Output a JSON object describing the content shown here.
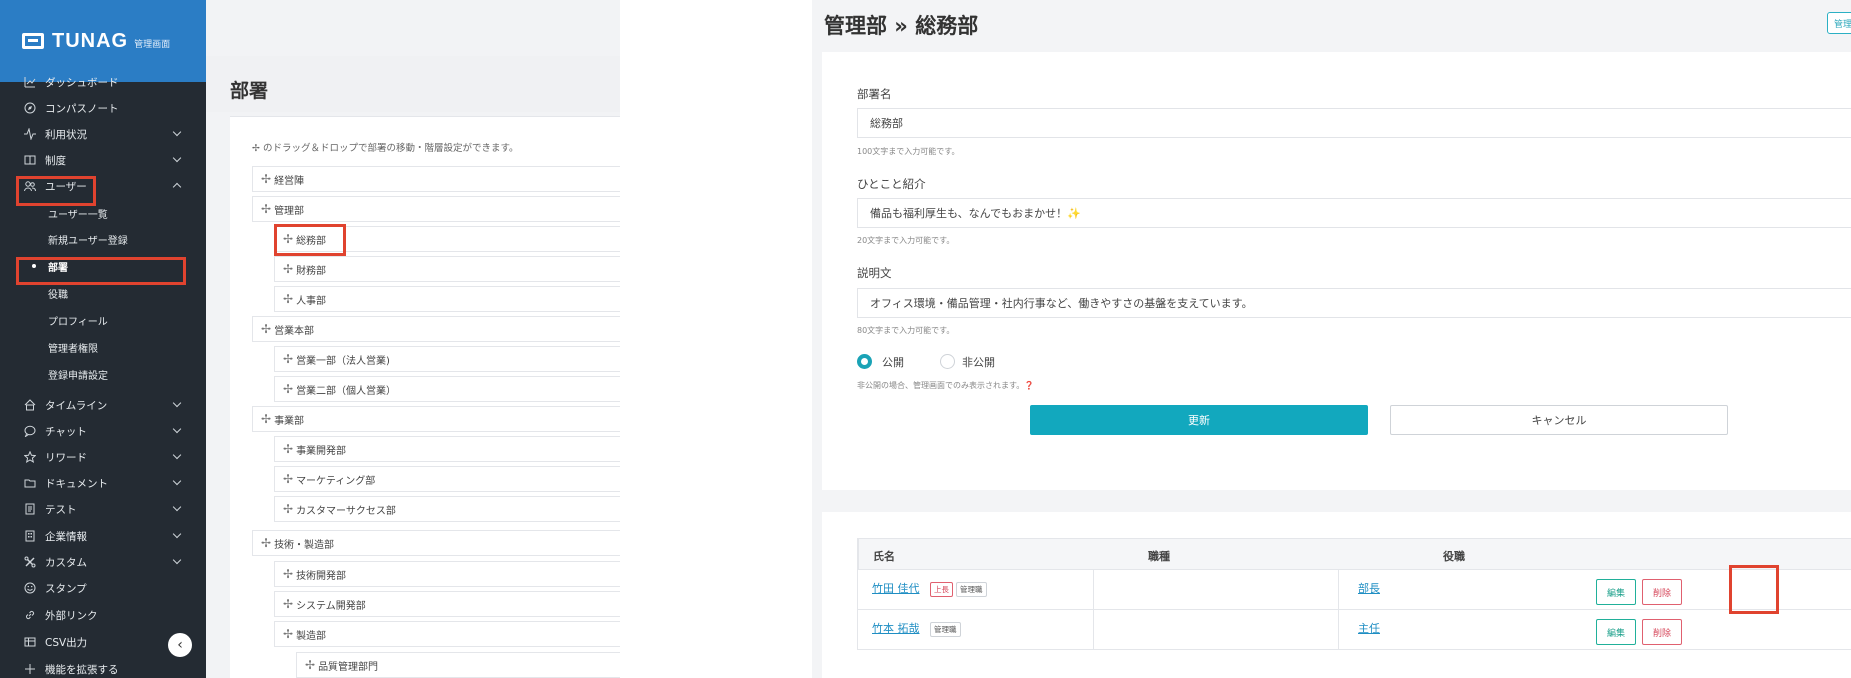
{
  "left": {
    "brand": {
      "name": "TUNAG",
      "sub": "管理画面"
    },
    "nav": [
      {
        "label": "ダッシュボード",
        "icon": "chart-line-icon",
        "chevron": false
      },
      {
        "label": "コンパスノート",
        "icon": "compass-icon",
        "chevron": false
      },
      {
        "label": "利用状況",
        "icon": "activity-icon",
        "chevron": "down"
      },
      {
        "label": "制度",
        "icon": "book-icon",
        "chevron": "down"
      },
      {
        "label": "ユーザー",
        "icon": "users-icon",
        "chevron": "up"
      }
    ],
    "user_sub": [
      {
        "label": "ユーザー一覧"
      },
      {
        "label": "新規ユーザー登録"
      },
      {
        "label": "部署",
        "active": true
      },
      {
        "label": "役職"
      },
      {
        "label": "プロフィール"
      },
      {
        "label": "管理者権限"
      },
      {
        "label": "登録申請設定"
      }
    ],
    "nav2": [
      {
        "label": "タイムライン",
        "icon": "home-icon",
        "chevron": "down"
      },
      {
        "label": "チャット",
        "icon": "chat-icon",
        "chevron": "down"
      },
      {
        "label": "リワード",
        "icon": "star-icon",
        "chevron": "down"
      },
      {
        "label": "ドキュメント",
        "icon": "folder-icon",
        "chevron": "down"
      },
      {
        "label": "テスト",
        "icon": "test-icon",
        "chevron": "down"
      },
      {
        "label": "企業情報",
        "icon": "building-icon",
        "chevron": "down"
      },
      {
        "label": "カスタム",
        "icon": "custom-icon",
        "chevron": "down"
      },
      {
        "label": "スタンプ",
        "icon": "smile-icon",
        "chevron": false
      },
      {
        "label": "外部リンク",
        "icon": "link-icon",
        "chevron": false
      },
      {
        "label": "CSV出力",
        "icon": "table-icon",
        "chevron": false
      },
      {
        "label": "機能を拡張する",
        "icon": "extend-icon",
        "chevron": false
      }
    ],
    "page_title": "部署",
    "hint": "✢ のドラッグ＆ドロップで部署の移動・階層設定ができます。",
    "departments": [
      {
        "label": "経営陣",
        "level": 0
      },
      {
        "label": "管理部",
        "level": 0
      },
      {
        "label": "総務部",
        "level": 1
      },
      {
        "label": "財務部",
        "level": 1
      },
      {
        "label": "人事部",
        "level": 1
      },
      {
        "label": "営業本部",
        "level": 0
      },
      {
        "label": "営業一部（法人営業)",
        "level": 1
      },
      {
        "label": "営業二部（個人営業）",
        "level": 1
      },
      {
        "label": "事業部",
        "level": 0
      },
      {
        "label": "事業開発部",
        "level": 1
      },
      {
        "label": "マーケティング部",
        "level": 1
      },
      {
        "label": "カスタマーサクセス部",
        "level": 1
      },
      {
        "label": "技術・製造部",
        "level": 0
      },
      {
        "label": "技術開発部",
        "level": 1
      },
      {
        "label": "システム開発部",
        "level": 1
      },
      {
        "label": "製造部",
        "level": 1
      },
      {
        "label": "品質管理部門",
        "level": 2
      }
    ]
  },
  "right": {
    "title": "管理部 » 総務部",
    "corner_button": "管理",
    "form": {
      "name_label": "部署名",
      "name_value": "総務部",
      "name_help": "100文字まで入力可能です。",
      "intro_label": "ひとこと紹介",
      "intro_value": "備品も福利厚生も、なんでもおまかせ！✨",
      "intro_help": "20文字まで入力可能です。",
      "desc_label": "説明文",
      "desc_value": "オフィス環境・備品管理・社内行事など、働きやすさの基盤を支えています。",
      "desc_help": "80文字まで入力可能です。",
      "radio_public": "公開",
      "radio_private": "非公開",
      "visibility_help": "非公開の場合、管理画面でのみ表示されます。❓",
      "update_label": "更新",
      "cancel_label": "キャンセル"
    },
    "table": {
      "headers": [
        "氏名",
        "職種",
        "役職"
      ],
      "rows": [
        {
          "name": "竹田 佳代",
          "badges": [
            "上長",
            "管理職"
          ],
          "job": "",
          "position": "部長",
          "edit": "編集",
          "delete": "削除"
        },
        {
          "name": "竹本 拓哉",
          "badges": [
            "管理職"
          ],
          "job": "",
          "position": "主任",
          "edit": "編集",
          "delete": "削除"
        }
      ]
    }
  }
}
